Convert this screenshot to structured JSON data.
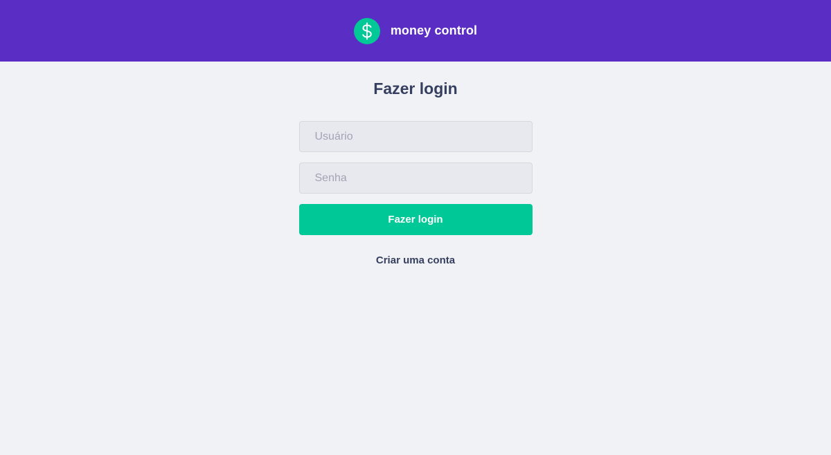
{
  "header": {
    "brand": "money control",
    "logo_icon": "dollar-sign-icon",
    "background_color": "#5a2ec4",
    "logo_color": "#00c897"
  },
  "login": {
    "title": "Fazer login",
    "username_placeholder": "Usuário",
    "username_value": "",
    "password_placeholder": "Senha",
    "password_value": "",
    "submit_label": "Fazer login",
    "create_account_label": "Criar uma conta",
    "accent_color": "#00c897"
  }
}
